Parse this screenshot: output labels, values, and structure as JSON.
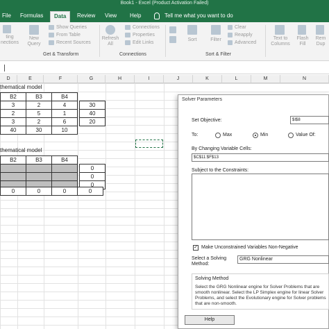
{
  "window": {
    "title": "Book1 - Excel (Product Activation Failed)"
  },
  "tabs": [
    "File",
    "Formulas",
    "Data",
    "Review",
    "View",
    "Help"
  ],
  "active_tab": "Data",
  "tell_me": "Tell me what you want to do",
  "ribbon": {
    "get_data_fragment": "ting\nnections",
    "new_query": "New\nQuery",
    "show_queries": "Show Queries",
    "from_table": "From Table",
    "recent_sources": "Recent Sources",
    "group_get_transform": "Get & Transform",
    "refresh_all": "Refresh\nAll",
    "connections": "Connections",
    "properties": "Properties",
    "edit_links": "Edit Links",
    "group_connections": "Connections",
    "sort": "Sort",
    "filter": "Filter",
    "clear": "Clear",
    "reapply": "Reapply",
    "advanced": "Advanced",
    "group_sort_filter": "Sort & Filter",
    "text_to_columns": "Text to\nColumns",
    "flash_fill": "Flash\nFill",
    "remove": "Rem\nDup"
  },
  "columns": [
    "D",
    "E",
    "F",
    "G",
    "H",
    "I",
    "J",
    "K",
    "L",
    "M",
    "N"
  ],
  "sheet": {
    "heading1": "thematical model",
    "table1_header": [
      "B2",
      "B3",
      "B4"
    ],
    "table1_rows": [
      [
        "3",
        "2",
        "4"
      ],
      [
        "2",
        "5",
        "1"
      ],
      [
        "3",
        "2",
        "6"
      ],
      [
        "40",
        "30",
        "10"
      ]
    ],
    "table1_g": [
      "30",
      "40",
      "20"
    ],
    "heading2": "thematical model",
    "table2_header": [
      "B2",
      "B3",
      "B4"
    ],
    "table2_g": [
      "0",
      "0",
      "0"
    ],
    "table2_total": [
      "0",
      "0",
      "0",
      "0"
    ]
  },
  "solver": {
    "title": "Solver Parameters",
    "set_objective_label": "Set Objective:",
    "set_objective_value": "$I$8",
    "to_label": "To:",
    "max": "Max",
    "min": "Min",
    "value_of": "Value Of:",
    "selected": "Min",
    "changing_label": "By Changing Variable Cells:",
    "changing_value": "$C$11:$F$13",
    "constraints_label": "Subject to the Constraints:",
    "nonneg_label": "Make Unconstrained Variables Non-Negative",
    "nonneg_checked": true,
    "method_label": "Select a Solving\nMethod:",
    "method_value": "GRG Nonlinear",
    "solving_method_heading": "Solving Method",
    "solving_method_text": "Select the GRG Nonlinear engine for Solver Problems that are smooth nonlinear. Select the LP Simplex engine for linear Solver Problems, and select the Evolutionary engine for Solver problems that are non-smooth.",
    "help": "Help"
  }
}
